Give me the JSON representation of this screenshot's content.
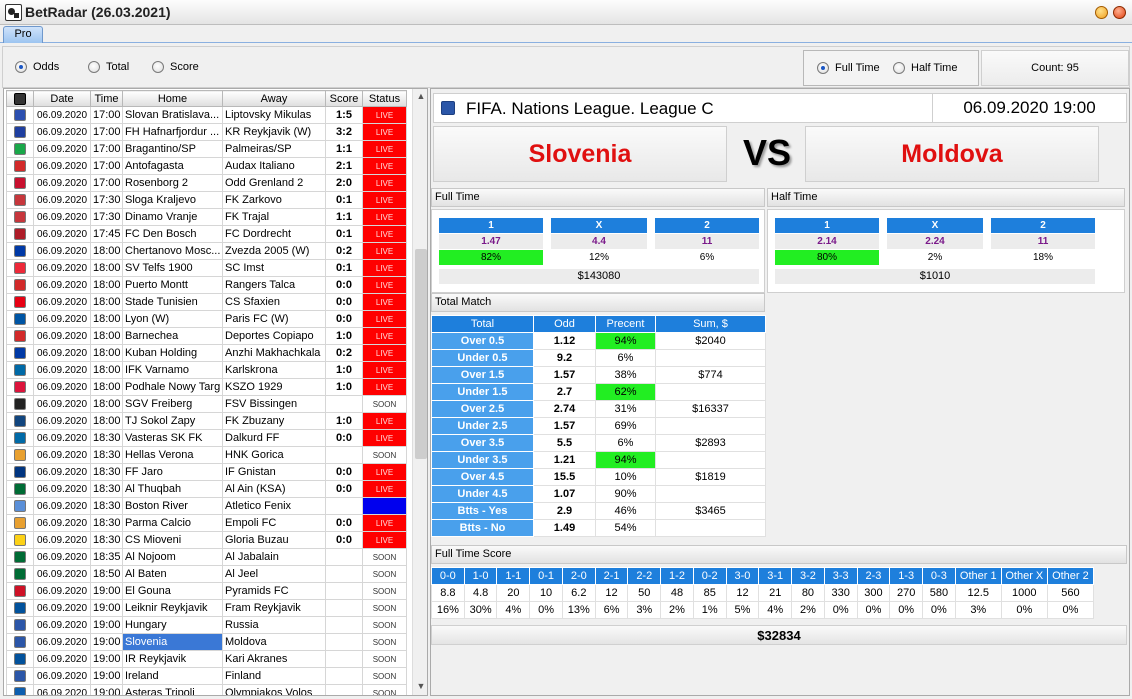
{
  "window": {
    "title": "BetRadar (26.03.2021)"
  },
  "tabs": [
    {
      "label": "Pro"
    }
  ],
  "mode_options": [
    {
      "label": "Odds",
      "selected": true
    },
    {
      "label": "Total",
      "selected": false
    },
    {
      "label": "Score",
      "selected": false
    }
  ],
  "period_options": [
    {
      "label": "Full Time",
      "selected": true
    },
    {
      "label": "Half Time",
      "selected": false
    }
  ],
  "count_label": "Count: 95",
  "matches": {
    "columns": [
      "",
      "Date",
      "Time",
      "Home",
      "Away",
      "Score",
      "Status"
    ],
    "rows": [
      {
        "date": "06.09.2020",
        "time": "17:00",
        "home": "Slovan Bratislava...",
        "away": "Liptovsky Mikulas",
        "score": "1:5",
        "status": "LIVE",
        "flag": "#2b4fb0"
      },
      {
        "date": "06.09.2020",
        "time": "17:00",
        "home": "FH Hafnarfjordur ...",
        "away": "KR Reykjavik (W)",
        "score": "3:2",
        "status": "LIVE",
        "flag": "#1f3fa0"
      },
      {
        "date": "06.09.2020",
        "time": "17:00",
        "home": "Bragantino/SP",
        "away": "Palmeiras/SP",
        "score": "1:1",
        "status": "LIVE",
        "flag": "#1aa84a"
      },
      {
        "date": "06.09.2020",
        "time": "17:00",
        "home": "Antofagasta",
        "away": "Audax Italiano",
        "score": "2:1",
        "status": "LIVE",
        "flag": "#d22a2a"
      },
      {
        "date": "06.09.2020",
        "time": "17:00",
        "home": "Rosenborg 2",
        "away": "Odd Grenland 2",
        "score": "2:0",
        "status": "LIVE",
        "flag": "#c8102e"
      },
      {
        "date": "06.09.2020",
        "time": "17:30",
        "home": "Sloga Kraljevo",
        "away": "FK Zarkovo",
        "score": "0:1",
        "status": "LIVE",
        "flag": "#c6363c"
      },
      {
        "date": "06.09.2020",
        "time": "17:30",
        "home": "Dinamo Vranje",
        "away": "FK Trajal",
        "score": "1:1",
        "status": "LIVE",
        "flag": "#c6363c"
      },
      {
        "date": "06.09.2020",
        "time": "17:45",
        "home": "FC Den Bosch",
        "away": "FC Dordrecht",
        "score": "0:1",
        "status": "LIVE",
        "flag": "#ae1c28"
      },
      {
        "date": "06.09.2020",
        "time": "18:00",
        "home": "Chertanovo Mosc...",
        "away": "Zvezda 2005 (W)",
        "score": "0:2",
        "status": "LIVE",
        "flag": "#0039a6"
      },
      {
        "date": "06.09.2020",
        "time": "18:00",
        "home": "SV Telfs 1900",
        "away": "SC Imst",
        "score": "0:1",
        "status": "LIVE",
        "flag": "#ed2939"
      },
      {
        "date": "06.09.2020",
        "time": "18:00",
        "home": "Puerto Montt",
        "away": "Rangers Talca",
        "score": "0:0",
        "status": "LIVE",
        "flag": "#d22a2a"
      },
      {
        "date": "06.09.2020",
        "time": "18:00",
        "home": "Stade Tunisien",
        "away": "CS Sfaxien",
        "score": "0:0",
        "status": "LIVE",
        "flag": "#e70013"
      },
      {
        "date": "06.09.2020",
        "time": "18:00",
        "home": "Lyon (W)",
        "away": "Paris FC (W)",
        "score": "0:0",
        "status": "LIVE",
        "flag": "#0055a4"
      },
      {
        "date": "06.09.2020",
        "time": "18:00",
        "home": "Barnechea",
        "away": "Deportes Copiapo",
        "score": "1:0",
        "status": "LIVE",
        "flag": "#d22a2a"
      },
      {
        "date": "06.09.2020",
        "time": "18:00",
        "home": "Kuban Holding",
        "away": "Anzhi Makhachkala",
        "score": "0:2",
        "status": "LIVE",
        "flag": "#0039a6"
      },
      {
        "date": "06.09.2020",
        "time": "18:00",
        "home": "IFK Varnamo",
        "away": "Karlskrona",
        "score": "1:0",
        "status": "LIVE",
        "flag": "#006aa7"
      },
      {
        "date": "06.09.2020",
        "time": "18:00",
        "home": "Podhale Nowy Targ",
        "away": "KSZO 1929",
        "score": "1:0",
        "status": "LIVE",
        "flag": "#dc143c"
      },
      {
        "date": "06.09.2020",
        "time": "18:00",
        "home": "SGV Freiberg",
        "away": "FSV Bissingen",
        "score": "",
        "status": "SOON",
        "flag": "#222222"
      },
      {
        "date": "06.09.2020",
        "time": "18:00",
        "home": "TJ Sokol Zapy",
        "away": "FK Zbuzany",
        "score": "1:0",
        "status": "LIVE",
        "flag": "#11457e"
      },
      {
        "date": "06.09.2020",
        "time": "18:30",
        "home": "Vasteras SK FK",
        "away": "Dalkurd FF",
        "score": "0:0",
        "status": "LIVE",
        "flag": "#006aa7"
      },
      {
        "date": "06.09.2020",
        "time": "18:30",
        "home": "Hellas Verona",
        "away": "HNK Gorica",
        "score": "",
        "status": "SOON",
        "flag": "#e8a030"
      },
      {
        "date": "06.09.2020",
        "time": "18:30",
        "home": "FF Jaro",
        "away": "IF Gnistan",
        "score": "0:0",
        "status": "LIVE",
        "flag": "#003580"
      },
      {
        "date": "06.09.2020",
        "time": "18:30",
        "home": "Al Thuqbah",
        "away": "Al Ain (KSA)",
        "score": "0:0",
        "status": "LIVE",
        "flag": "#006c35"
      },
      {
        "date": "06.09.2020",
        "time": "18:30",
        "home": "Boston River",
        "away": "Atletico Fenix",
        "score": "",
        "status": "BLUE",
        "flag": "#5a8fd8"
      },
      {
        "date": "06.09.2020",
        "time": "18:30",
        "home": "Parma Calcio",
        "away": "Empoli FC",
        "score": "0:0",
        "status": "LIVE",
        "flag": "#e8a030"
      },
      {
        "date": "06.09.2020",
        "time": "18:30",
        "home": "CS Mioveni",
        "away": "Gloria Buzau",
        "score": "0:0",
        "status": "LIVE",
        "flag": "#fcd116"
      },
      {
        "date": "06.09.2020",
        "time": "18:35",
        "home": "Al Nojoom",
        "away": "Al Jabalain",
        "score": "",
        "status": "SOON",
        "flag": "#006c35"
      },
      {
        "date": "06.09.2020",
        "time": "18:50",
        "home": "Al Baten",
        "away": "Al Jeel",
        "score": "",
        "status": "SOON",
        "flag": "#006c35"
      },
      {
        "date": "06.09.2020",
        "time": "19:00",
        "home": "El Gouna",
        "away": "Pyramids FC",
        "score": "",
        "status": "SOON",
        "flag": "#ce1126"
      },
      {
        "date": "06.09.2020",
        "time": "19:00",
        "home": "Leiknir Reykjavik",
        "away": "Fram Reykjavik",
        "score": "",
        "status": "SOON",
        "flag": "#02529c"
      },
      {
        "date": "06.09.2020",
        "time": "19:00",
        "home": "Hungary",
        "away": "Russia",
        "score": "",
        "status": "SOON",
        "flag": "#2b56a8"
      },
      {
        "date": "06.09.2020",
        "time": "19:00",
        "home": "Slovenia",
        "away": "Moldova",
        "score": "",
        "status": "SOON",
        "flag": "#2b56a8",
        "selected": true
      },
      {
        "date": "06.09.2020",
        "time": "19:00",
        "home": "IR Reykjavik",
        "away": "Kari Akranes",
        "score": "",
        "status": "SOON",
        "flag": "#02529c"
      },
      {
        "date": "06.09.2020",
        "time": "19:00",
        "home": "Ireland",
        "away": "Finland",
        "score": "",
        "status": "SOON",
        "flag": "#2b56a8"
      },
      {
        "date": "06.09.2020",
        "time": "19:00",
        "home": "Asteras Tripoli",
        "away": "Olympiakos Volos",
        "score": "",
        "status": "SOON",
        "flag": "#0d5eaf"
      }
    ]
  },
  "match": {
    "league": "FIFA. Nations League. League C",
    "datetime": "06.09.2020 19:00",
    "home": "Slovenia",
    "away": "Moldova",
    "vs": "VS"
  },
  "full_time": {
    "title": "Full Time",
    "headers": [
      "1",
      "X",
      "2"
    ],
    "odds": [
      "1.47",
      "4.4",
      "11"
    ],
    "percents": [
      "82%",
      "12%",
      "6%"
    ],
    "highlight": 0,
    "total": "$143080"
  },
  "half_time": {
    "title": "Half Time",
    "headers": [
      "1",
      "X",
      "2"
    ],
    "odds": [
      "2.14",
      "2.24",
      "11"
    ],
    "percents": [
      "80%",
      "2%",
      "18%"
    ],
    "highlight": 0,
    "total": "$1010"
  },
  "total_match": {
    "title": "Total Match",
    "columns": [
      "Total",
      "Odd",
      "Precent",
      "Sum, $"
    ],
    "rows": [
      {
        "label": "Over 0.5",
        "odd": "1.12",
        "pct": "94%",
        "sum": "$2040",
        "green": true
      },
      {
        "label": "Under 0.5",
        "odd": "9.2",
        "pct": "6%",
        "sum": "",
        "green": false
      },
      {
        "label": "Over 1.5",
        "odd": "1.57",
        "pct": "38%",
        "sum": "$774",
        "green": false
      },
      {
        "label": "Under 1.5",
        "odd": "2.7",
        "pct": "62%",
        "sum": "",
        "green": true
      },
      {
        "label": "Over 2.5",
        "odd": "2.74",
        "pct": "31%",
        "sum": "$16337",
        "green": false
      },
      {
        "label": "Under 2.5",
        "odd": "1.57",
        "pct": "69%",
        "sum": "",
        "green": false
      },
      {
        "label": "Over 3.5",
        "odd": "5.5",
        "pct": "6%",
        "sum": "$2893",
        "green": false
      },
      {
        "label": "Under 3.5",
        "odd": "1.21",
        "pct": "94%",
        "sum": "",
        "green": true
      },
      {
        "label": "Over 4.5",
        "odd": "15.5",
        "pct": "10%",
        "sum": "$1819",
        "green": false
      },
      {
        "label": "Under 4.5",
        "odd": "1.07",
        "pct": "90%",
        "sum": "",
        "green": false
      },
      {
        "label": "Btts - Yes",
        "odd": "2.9",
        "pct": "46%",
        "sum": "$3465",
        "green": false
      },
      {
        "label": "Btts - No",
        "odd": "1.49",
        "pct": "54%",
        "sum": "",
        "green": false
      }
    ]
  },
  "full_time_score": {
    "title": "Full Time Score",
    "headers": [
      "0-0",
      "1-0",
      "1-1",
      "0-1",
      "2-0",
      "2-1",
      "2-2",
      "1-2",
      "0-2",
      "3-0",
      "3-1",
      "3-2",
      "3-3",
      "2-3",
      "1-3",
      "0-3",
      "Other 1",
      "Other X",
      "Other 2"
    ],
    "odds": [
      "8.8",
      "4.8",
      "20",
      "10",
      "6.2",
      "12",
      "50",
      "48",
      "85",
      "12",
      "21",
      "80",
      "330",
      "300",
      "270",
      "580",
      "12.5",
      "1000",
      "560"
    ],
    "percents": [
      "16%",
      "30%",
      "4%",
      "0%",
      "13%",
      "6%",
      "3%",
      "2%",
      "1%",
      "5%",
      "4%",
      "2%",
      "0%",
      "0%",
      "0%",
      "0%",
      "3%",
      "0%",
      "0%"
    ],
    "total": "$32834"
  },
  "colors": {
    "accent": "#1e7fdc",
    "live": "#ff0000",
    "highlight": "#22ee22",
    "team": "#e01010"
  }
}
